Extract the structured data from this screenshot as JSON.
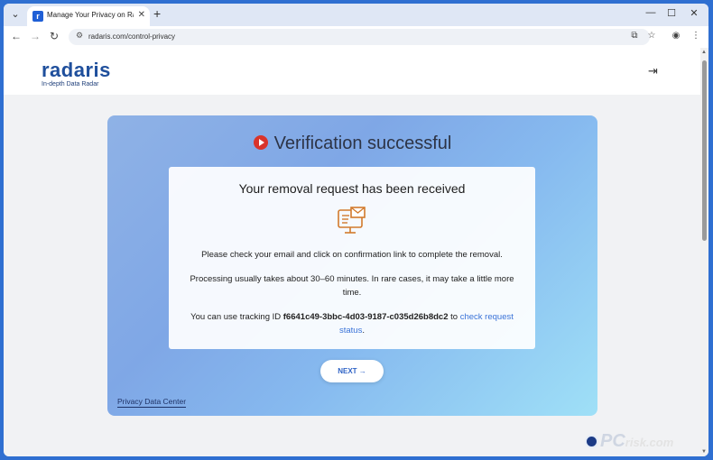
{
  "browser": {
    "tab_title": "Manage Your Privacy on Radaris",
    "favicon_letter": "r",
    "url": "radaris.com/control-privacy"
  },
  "site": {
    "logo": "radaris",
    "tagline": "In-depth Data Radar"
  },
  "card": {
    "heading": "Verification successful",
    "inner_title": "Your removal request has been received",
    "p1": "Please check your email and click on confirmation link to complete the removal.",
    "p2": "Processing usually takes about 30–60 minutes. In rare cases, it may take a little more time.",
    "p3_prefix": "You can use tracking ID",
    "tracking_id": "f6641c49-3bbc-4d03-9187-c035d26b8dc2",
    "p3_mid": "to",
    "status_link": "check request status",
    "p3_suffix": ".",
    "next_label": "NEXT →",
    "footer_link": "Privacy Data Center"
  },
  "watermark": {
    "brand": "PC",
    "suffix": "risk.com"
  }
}
